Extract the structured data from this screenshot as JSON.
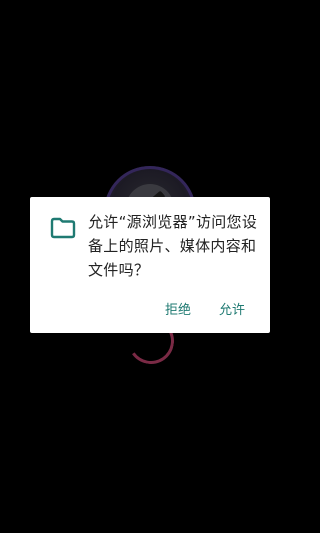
{
  "background": {
    "app_logo_icon": "browser-logo-icon",
    "spinner_icon": "loading-spinner-icon",
    "scrim_color": "#000000"
  },
  "dialog": {
    "icon": "folder-icon",
    "message": "允许“源浏览器”访问您设备上的照片、媒体内容和文件吗？",
    "deny_label": "拒绝",
    "allow_label": "允许",
    "accent_color": "#1f7a72"
  }
}
